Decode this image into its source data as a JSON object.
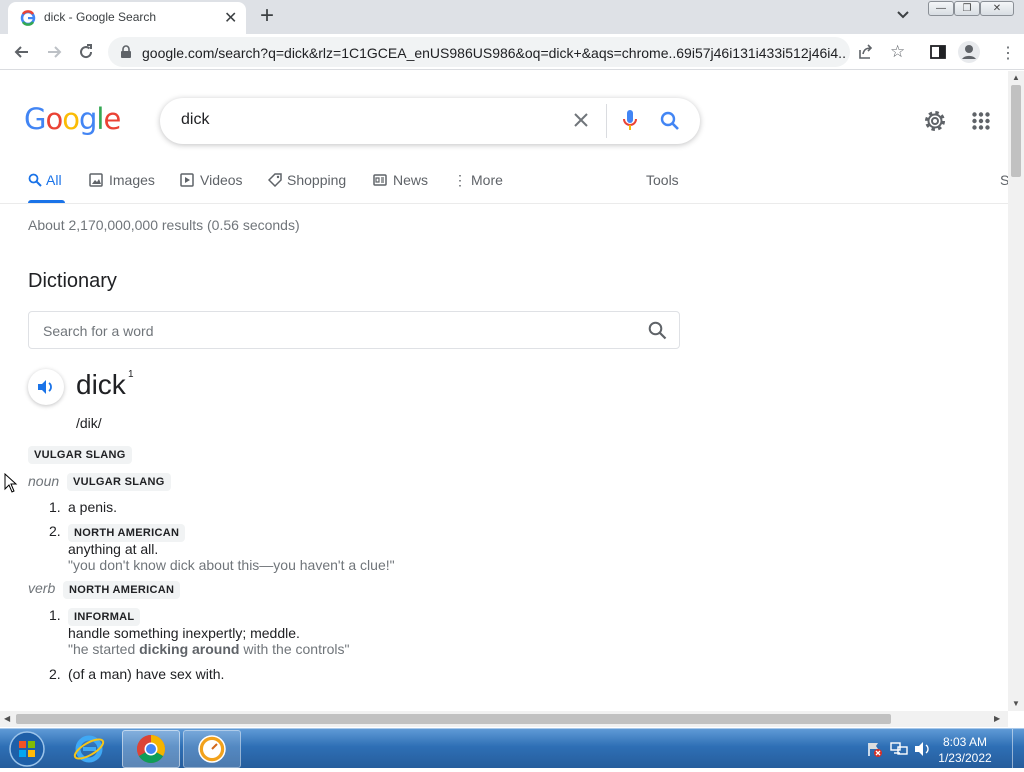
{
  "browser": {
    "tab_title": "dick - Google Search",
    "url": "google.com/search?q=dick&rlz=1C1GCEA_enUS986US986&oq=dick+&aqs=chrome..69i57j46i131i433i512j46i4..."
  },
  "google": {
    "logo_letters": [
      "G",
      "o",
      "o",
      "g",
      "l",
      "e"
    ],
    "logo_colors": [
      "#4285f4",
      "#ea4335",
      "#fbbc05",
      "#4285f4",
      "#34a853",
      "#ea4335"
    ],
    "search_value": "dick"
  },
  "nav": {
    "all": "All",
    "images": "Images",
    "videos": "Videos",
    "shopping": "Shopping",
    "news": "News",
    "more": "More",
    "tools": "Tools",
    "cut_label": "S"
  },
  "results": {
    "stats": "About 2,170,000,000 results (0.56 seconds)"
  },
  "dictionary": {
    "heading": "Dictionary",
    "search_placeholder": "Search for a word",
    "headword": "dick",
    "superscript": "1",
    "phonetic": "/dik/",
    "top_badge": "VULGAR SLANG",
    "noun": {
      "pos": "noun",
      "badge": "VULGAR SLANG",
      "senses": [
        {
          "num": "1.",
          "definition": "a penis."
        },
        {
          "num": "2.",
          "badge": "NORTH AMERICAN",
          "definition": "anything at all.",
          "example": "\"you don't know dick about this—you haven't a clue!\""
        }
      ]
    },
    "verb": {
      "pos": "verb",
      "badge": "NORTH AMERICAN",
      "senses": [
        {
          "num": "1.",
          "badge": "INFORMAL",
          "definition": "handle something inexpertly; meddle.",
          "example_before": "\"he started ",
          "example_bold": "dicking around",
          "example_after": " with the controls\""
        },
        {
          "num": "2.",
          "definition": "(of a man) have sex with."
        }
      ]
    }
  },
  "taskbar": {
    "time": "8:03 AM",
    "date": "1/23/2022"
  },
  "colors": {
    "accent": "#1a73e8",
    "mic_red": "#ea4335",
    "taskbar": "#2e6fb5"
  }
}
